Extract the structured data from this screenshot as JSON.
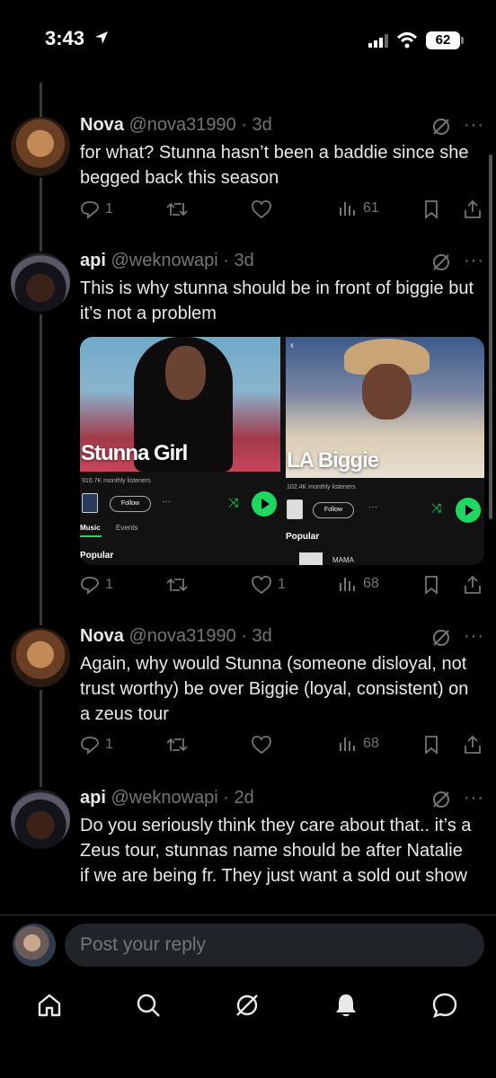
{
  "status_bar": {
    "time": "3:43",
    "battery": "62"
  },
  "tweets": [
    {
      "name": "Nova",
      "handle": "@nova31990 · 3d",
      "text": "for what? Stunna hasn’t been a baddie since she begged back this season",
      "replies": "1",
      "reposts": "",
      "likes": "",
      "views": "61"
    },
    {
      "name": "api",
      "handle": "@weknowapi · 3d",
      "text": "This is why stunna should be in front of biggie but it’s not a problem",
      "replies": "1",
      "reposts": "",
      "likes": "1",
      "views": "68",
      "media": {
        "card1": {
          "artist": "Stunna Girl",
          "listeners": "910.7K monthly listeners",
          "follow": "Follow",
          "tab_music": "Music",
          "tab_events": "Events",
          "section": "Popular"
        },
        "card2": {
          "artist": "LA Biggie",
          "listeners": "102.4K monthly listeners",
          "follow": "Follow",
          "section": "Popular",
          "track": "MAMA"
        }
      }
    },
    {
      "name": "Nova",
      "handle": "@nova31990 · 3d",
      "text": "Again, why would Stunna (someone disloyal, not trust worthy) be over Biggie (loyal, consistent) on a zeus tour",
      "replies": "1",
      "reposts": "",
      "likes": "",
      "views": "68"
    },
    {
      "name": "api",
      "handle": "@weknowapi · 2d",
      "text": "Do you seriously think they care about that.. it’s a Zeus tour, stunnas name should be after Natalie if we are being fr. They just want a sold out show"
    }
  ],
  "reply": {
    "placeholder": "Post your reply"
  },
  "nav": [
    "home-icon",
    "search-icon",
    "grok-icon",
    "notifications-icon",
    "messages-icon"
  ],
  "colors": {
    "background": "#000000",
    "text": "#e7e9ea",
    "muted": "#71767b",
    "spotify_green": "#1ed760"
  }
}
